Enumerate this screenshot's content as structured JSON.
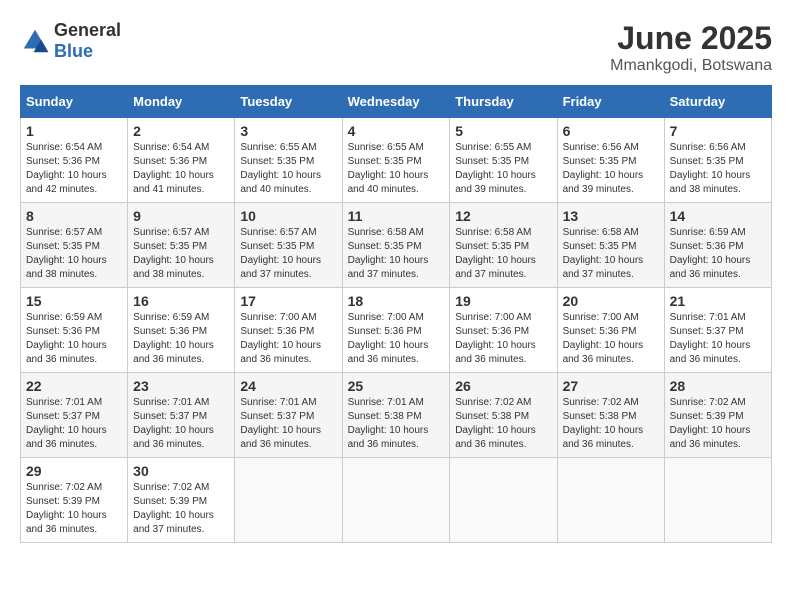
{
  "logo": {
    "general": "General",
    "blue": "Blue"
  },
  "header": {
    "month": "June 2025",
    "location": "Mmankgodi, Botswana"
  },
  "weekdays": [
    "Sunday",
    "Monday",
    "Tuesday",
    "Wednesday",
    "Thursday",
    "Friday",
    "Saturday"
  ],
  "weeks": [
    [
      {
        "day": "1",
        "sunrise": "6:54 AM",
        "sunset": "5:36 PM",
        "daylight": "10 hours and 42 minutes."
      },
      {
        "day": "2",
        "sunrise": "6:54 AM",
        "sunset": "5:36 PM",
        "daylight": "10 hours and 41 minutes."
      },
      {
        "day": "3",
        "sunrise": "6:55 AM",
        "sunset": "5:35 PM",
        "daylight": "10 hours and 40 minutes."
      },
      {
        "day": "4",
        "sunrise": "6:55 AM",
        "sunset": "5:35 PM",
        "daylight": "10 hours and 40 minutes."
      },
      {
        "day": "5",
        "sunrise": "6:55 AM",
        "sunset": "5:35 PM",
        "daylight": "10 hours and 39 minutes."
      },
      {
        "day": "6",
        "sunrise": "6:56 AM",
        "sunset": "5:35 PM",
        "daylight": "10 hours and 39 minutes."
      },
      {
        "day": "7",
        "sunrise": "6:56 AM",
        "sunset": "5:35 PM",
        "daylight": "10 hours and 38 minutes."
      }
    ],
    [
      {
        "day": "8",
        "sunrise": "6:57 AM",
        "sunset": "5:35 PM",
        "daylight": "10 hours and 38 minutes."
      },
      {
        "day": "9",
        "sunrise": "6:57 AM",
        "sunset": "5:35 PM",
        "daylight": "10 hours and 38 minutes."
      },
      {
        "day": "10",
        "sunrise": "6:57 AM",
        "sunset": "5:35 PM",
        "daylight": "10 hours and 37 minutes."
      },
      {
        "day": "11",
        "sunrise": "6:58 AM",
        "sunset": "5:35 PM",
        "daylight": "10 hours and 37 minutes."
      },
      {
        "day": "12",
        "sunrise": "6:58 AM",
        "sunset": "5:35 PM",
        "daylight": "10 hours and 37 minutes."
      },
      {
        "day": "13",
        "sunrise": "6:58 AM",
        "sunset": "5:35 PM",
        "daylight": "10 hours and 37 minutes."
      },
      {
        "day": "14",
        "sunrise": "6:59 AM",
        "sunset": "5:36 PM",
        "daylight": "10 hours and 36 minutes."
      }
    ],
    [
      {
        "day": "15",
        "sunrise": "6:59 AM",
        "sunset": "5:36 PM",
        "daylight": "10 hours and 36 minutes."
      },
      {
        "day": "16",
        "sunrise": "6:59 AM",
        "sunset": "5:36 PM",
        "daylight": "10 hours and 36 minutes."
      },
      {
        "day": "17",
        "sunrise": "7:00 AM",
        "sunset": "5:36 PM",
        "daylight": "10 hours and 36 minutes."
      },
      {
        "day": "18",
        "sunrise": "7:00 AM",
        "sunset": "5:36 PM",
        "daylight": "10 hours and 36 minutes."
      },
      {
        "day": "19",
        "sunrise": "7:00 AM",
        "sunset": "5:36 PM",
        "daylight": "10 hours and 36 minutes."
      },
      {
        "day": "20",
        "sunrise": "7:00 AM",
        "sunset": "5:36 PM",
        "daylight": "10 hours and 36 minutes."
      },
      {
        "day": "21",
        "sunrise": "7:01 AM",
        "sunset": "5:37 PM",
        "daylight": "10 hours and 36 minutes."
      }
    ],
    [
      {
        "day": "22",
        "sunrise": "7:01 AM",
        "sunset": "5:37 PM",
        "daylight": "10 hours and 36 minutes."
      },
      {
        "day": "23",
        "sunrise": "7:01 AM",
        "sunset": "5:37 PM",
        "daylight": "10 hours and 36 minutes."
      },
      {
        "day": "24",
        "sunrise": "7:01 AM",
        "sunset": "5:37 PM",
        "daylight": "10 hours and 36 minutes."
      },
      {
        "day": "25",
        "sunrise": "7:01 AM",
        "sunset": "5:38 PM",
        "daylight": "10 hours and 36 minutes."
      },
      {
        "day": "26",
        "sunrise": "7:02 AM",
        "sunset": "5:38 PM",
        "daylight": "10 hours and 36 minutes."
      },
      {
        "day": "27",
        "sunrise": "7:02 AM",
        "sunset": "5:38 PM",
        "daylight": "10 hours and 36 minutes."
      },
      {
        "day": "28",
        "sunrise": "7:02 AM",
        "sunset": "5:39 PM",
        "daylight": "10 hours and 36 minutes."
      }
    ],
    [
      {
        "day": "29",
        "sunrise": "7:02 AM",
        "sunset": "5:39 PM",
        "daylight": "10 hours and 36 minutes."
      },
      {
        "day": "30",
        "sunrise": "7:02 AM",
        "sunset": "5:39 PM",
        "daylight": "10 hours and 37 minutes."
      },
      null,
      null,
      null,
      null,
      null
    ]
  ],
  "labels": {
    "sunrise": "Sunrise:",
    "sunset": "Sunset:",
    "daylight": "Daylight:"
  }
}
